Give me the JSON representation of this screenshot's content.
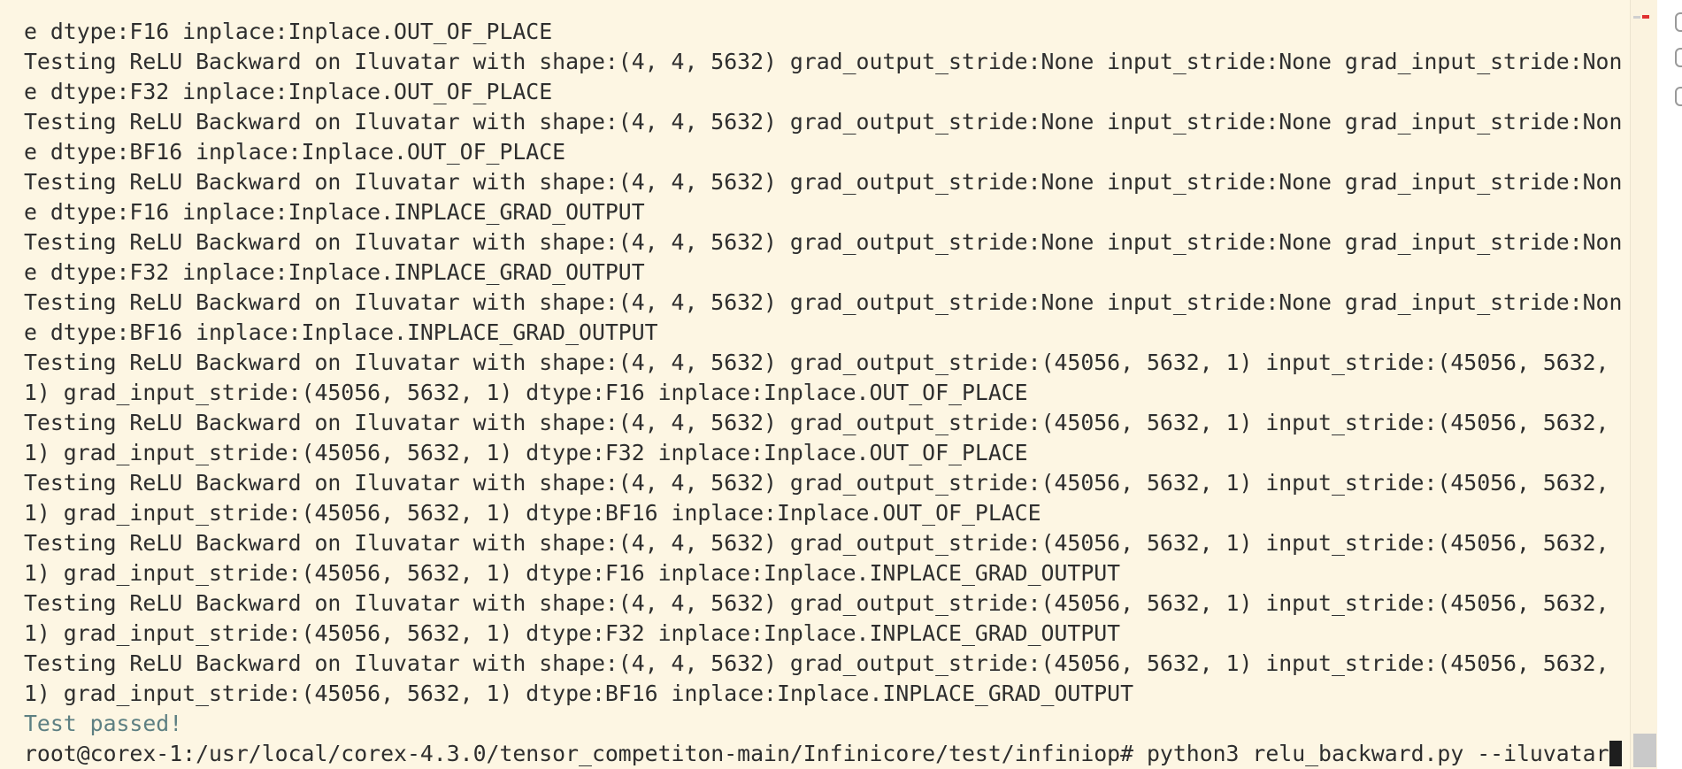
{
  "terminal": {
    "lines": [
      "e dtype:F16 inplace:Inplace.OUT_OF_PLACE",
      "Testing ReLU Backward on Iluvatar with shape:(4, 4, 5632) grad_output_stride:None input_stride:None grad_input_stride:Non",
      "e dtype:F32 inplace:Inplace.OUT_OF_PLACE",
      "Testing ReLU Backward on Iluvatar with shape:(4, 4, 5632) grad_output_stride:None input_stride:None grad_input_stride:Non",
      "e dtype:BF16 inplace:Inplace.OUT_OF_PLACE",
      "Testing ReLU Backward on Iluvatar with shape:(4, 4, 5632) grad_output_stride:None input_stride:None grad_input_stride:Non",
      "e dtype:F16 inplace:Inplace.INPLACE_GRAD_OUTPUT",
      "Testing ReLU Backward on Iluvatar with shape:(4, 4, 5632) grad_output_stride:None input_stride:None grad_input_stride:Non",
      "e dtype:F32 inplace:Inplace.INPLACE_GRAD_OUTPUT",
      "Testing ReLU Backward on Iluvatar with shape:(4, 4, 5632) grad_output_stride:None input_stride:None grad_input_stride:Non",
      "e dtype:BF16 inplace:Inplace.INPLACE_GRAD_OUTPUT",
      "Testing ReLU Backward on Iluvatar with shape:(4, 4, 5632) grad_output_stride:(45056, 5632, 1) input_stride:(45056, 5632,",
      "1) grad_input_stride:(45056, 5632, 1) dtype:F16 inplace:Inplace.OUT_OF_PLACE",
      "Testing ReLU Backward on Iluvatar with shape:(4, 4, 5632) grad_output_stride:(45056, 5632, 1) input_stride:(45056, 5632,",
      "1) grad_input_stride:(45056, 5632, 1) dtype:F32 inplace:Inplace.OUT_OF_PLACE",
      "Testing ReLU Backward on Iluvatar with shape:(4, 4, 5632) grad_output_stride:(45056, 5632, 1) input_stride:(45056, 5632,",
      "1) grad_input_stride:(45056, 5632, 1) dtype:BF16 inplace:Inplace.OUT_OF_PLACE",
      "Testing ReLU Backward on Iluvatar with shape:(4, 4, 5632) grad_output_stride:(45056, 5632, 1) input_stride:(45056, 5632,",
      "1) grad_input_stride:(45056, 5632, 1) dtype:F16 inplace:Inplace.INPLACE_GRAD_OUTPUT",
      "Testing ReLU Backward on Iluvatar with shape:(4, 4, 5632) grad_output_stride:(45056, 5632, 1) input_stride:(45056, 5632,",
      "1) grad_input_stride:(45056, 5632, 1) dtype:F32 inplace:Inplace.INPLACE_GRAD_OUTPUT",
      "Testing ReLU Backward on Iluvatar with shape:(4, 4, 5632) grad_output_stride:(45056, 5632, 1) input_stride:(45056, 5632,",
      "1) grad_input_stride:(45056, 5632, 1) dtype:BF16 inplace:Inplace.INPLACE_GRAD_OUTPUT"
    ],
    "status_line": "Test passed!",
    "prompt": "root@corex-1:/usr/local/corex-4.3.0/tensor_competiton-main/Infinicore/test/infiniop#",
    "command": "python3 relu_backward.py --iluvatar",
    "colors": {
      "background": "#fdf6e3",
      "text": "#2e2e2e",
      "status_text": "#5d7f82",
      "cursor": "#1e1e1e"
    }
  }
}
